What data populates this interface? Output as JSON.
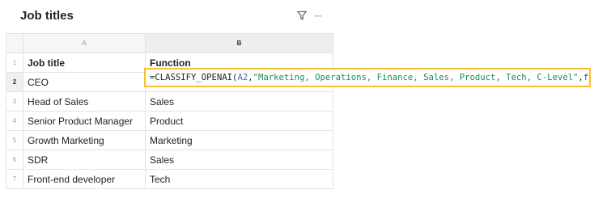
{
  "header": {
    "title": "Job titles",
    "filter_icon": "filter-icon",
    "more_icon": "more-horizontal-icon",
    "more_glyph": "···"
  },
  "sheet": {
    "columns": [
      "A",
      "B"
    ],
    "selected_row": "2",
    "rows": [
      {
        "num": "1",
        "a": "Job title",
        "b": "Function"
      },
      {
        "num": "2",
        "a": "CEO",
        "b": ""
      },
      {
        "num": "3",
        "a": "Head of Sales",
        "b": "Sales"
      },
      {
        "num": "4",
        "a": "Senior Product Manager",
        "b": "Product"
      },
      {
        "num": "5",
        "a": "Growth Marketing",
        "b": "Marketing"
      },
      {
        "num": "6",
        "a": "SDR",
        "b": "Sales"
      },
      {
        "num": "7",
        "a": "Front-end developer",
        "b": "Tech"
      }
    ]
  },
  "formula": {
    "fn": "=CLASSIFY_OPENAI(",
    "ref": "A2",
    "comma1": ",",
    "arg": "\"Marketing, Operations, Finance, Sales, Product, Tech, C-Level\"",
    "comma2": ",",
    "bool": "false",
    "close": ")"
  },
  "colors": {
    "accent_border": "#f2c230",
    "ref_color": "#3a6ec2",
    "string_color": "#1d8a5a",
    "bool_color": "#2b3fc9"
  }
}
